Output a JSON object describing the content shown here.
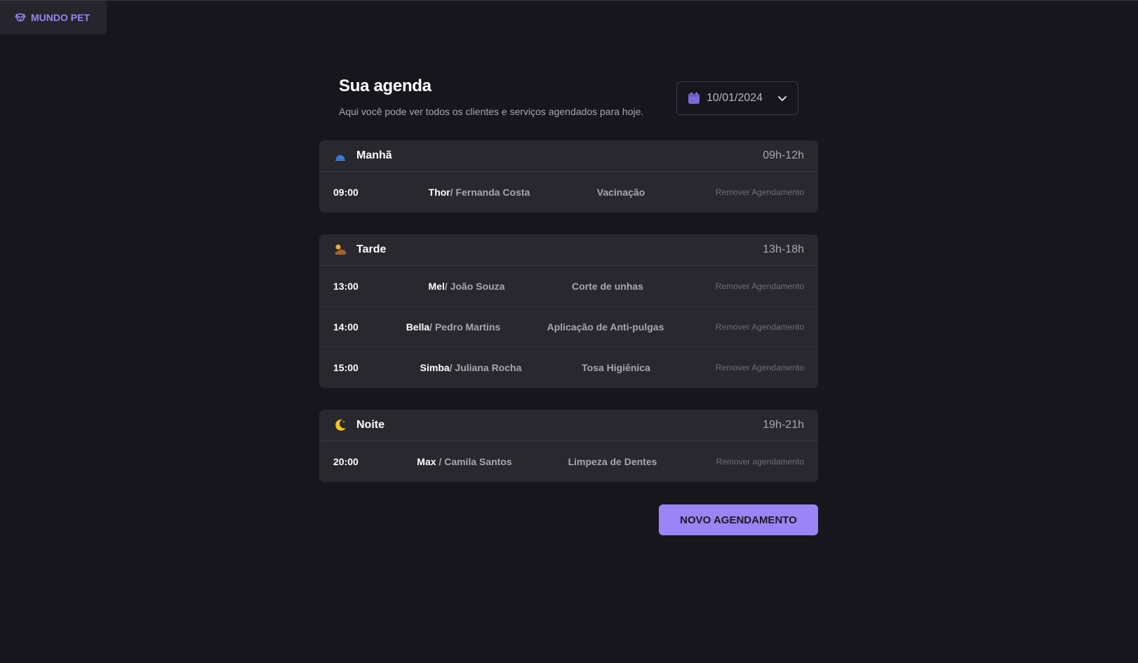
{
  "brand": {
    "name": "MUNDO PET",
    "icon": "dog-icon",
    "color": "#9b84f5"
  },
  "header": {
    "title": "Sua agenda",
    "subtitle": "Aqui você pode ver todos os clientes e serviços agendados para hoje."
  },
  "date_picker": {
    "value": "10/01/2024",
    "icon": "calendar-icon"
  },
  "periods": [
    {
      "name": "Manhã",
      "range": "09h-12h",
      "icon": "sunrise-icon",
      "appointments": [
        {
          "time": "09:00",
          "pet": "Thor",
          "owner": "/ Fernanda Costa",
          "service": "Vacinação",
          "remove": "Remover Agendamento"
        }
      ]
    },
    {
      "name": "Tarde",
      "range": "13h-18h",
      "icon": "sun-cloud-icon",
      "appointments": [
        {
          "time": "13:00",
          "pet": "Mel",
          "owner": "/ João Souza",
          "service": "Corte de unhas",
          "remove": "Remover Agendamento"
        },
        {
          "time": "14:00",
          "pet": "Bella",
          "owner": "/ Pedro Martins",
          "service": "Aplicação de Anti-pulgas",
          "remove": "Remover Agendamento"
        },
        {
          "time": "15:00",
          "pet": "Simba",
          "owner": "/ Juliana Rocha",
          "service": "Tosa Higiênica",
          "remove": "Remover Agendamento"
        }
      ]
    },
    {
      "name": "Noite",
      "range": "19h-21h",
      "icon": "moon-icon",
      "appointments": [
        {
          "time": "20:00",
          "pet": "Max",
          "owner": " / Camila Santos",
          "service": "Limpeza de Dentes",
          "remove": "Remover agendamento"
        }
      ]
    }
  ],
  "new_button": {
    "label": "NOVO AGENDAMENTO",
    "color": "#9b84f5"
  }
}
